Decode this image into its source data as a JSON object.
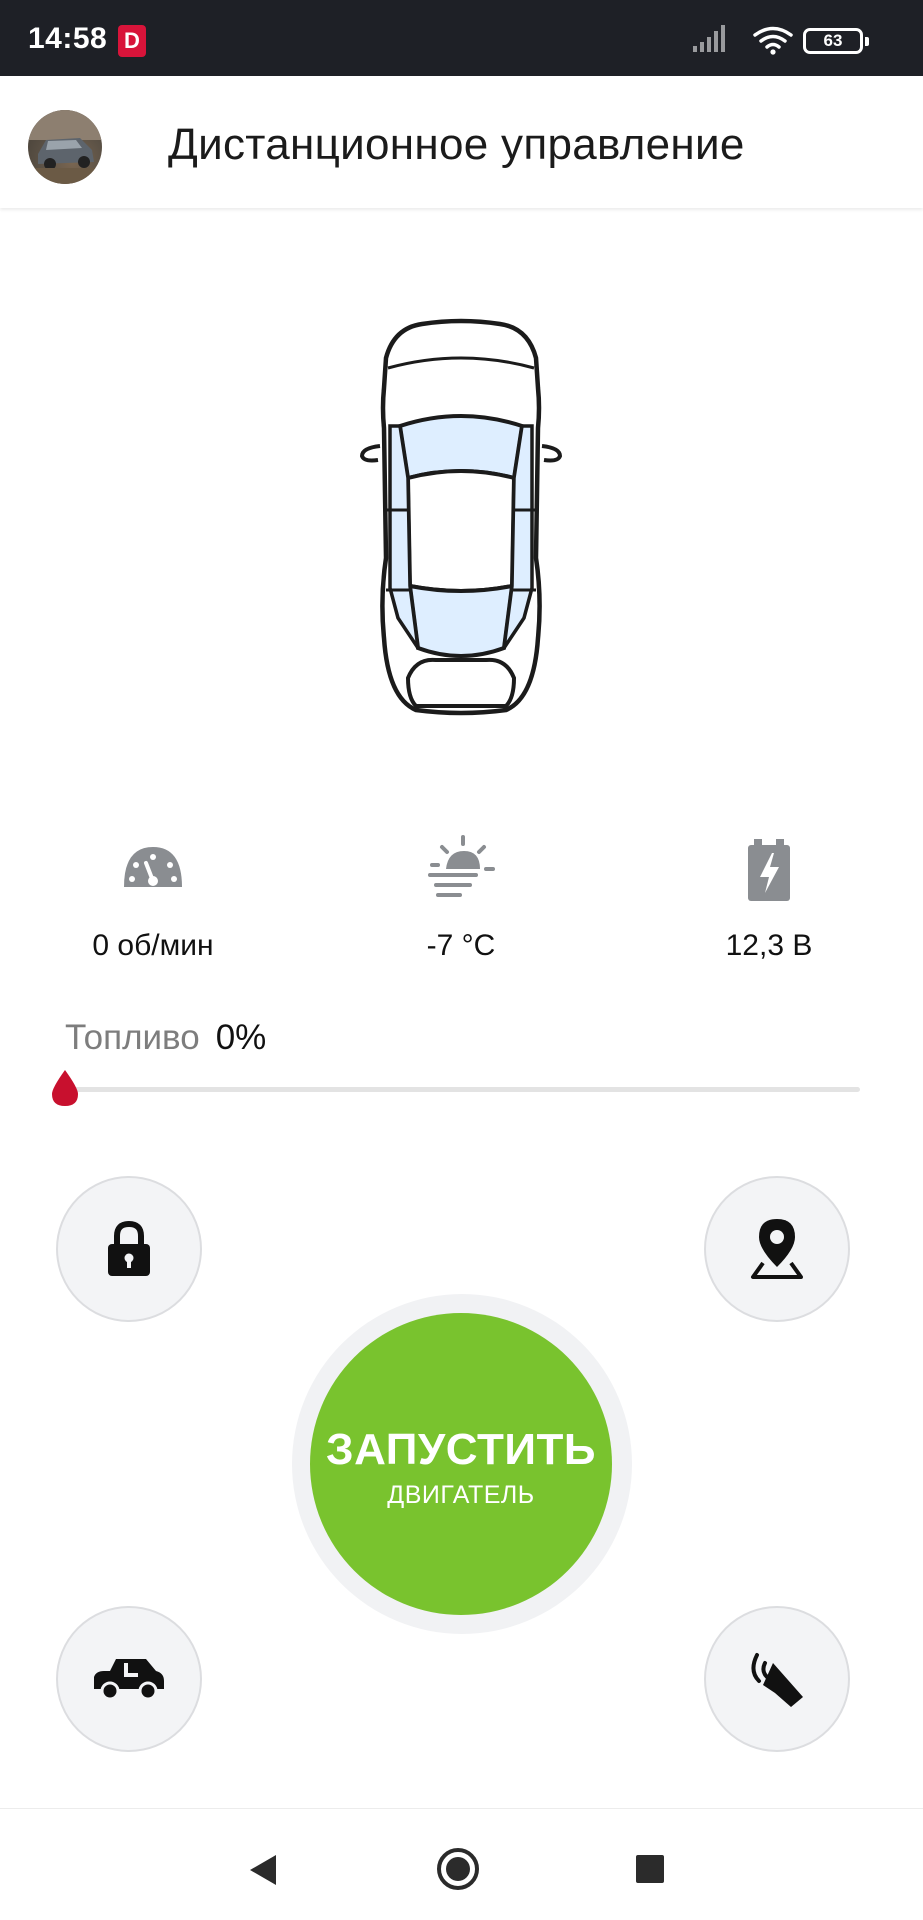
{
  "status_bar": {
    "time": "14:58",
    "app_badge": "D",
    "battery_level": "63"
  },
  "header": {
    "title": "Дистанционное управление",
    "avatar_icon": "car-photo-avatar"
  },
  "stats": {
    "rpm": {
      "icon": "speedometer-icon",
      "value": "0 об/мин"
    },
    "temperature": {
      "icon": "weather-sun-fog-icon",
      "value": "-7 °C"
    },
    "voltage": {
      "icon": "battery-charge-icon",
      "value": "12,3 В"
    }
  },
  "fuel": {
    "label": "Топливо",
    "value": "0%",
    "level": 0,
    "color": "#c8102e"
  },
  "actions": {
    "lock": {
      "icon": "lock-icon"
    },
    "location": {
      "icon": "map-pin-icon"
    },
    "trunk": {
      "icon": "car-trunk-icon"
    },
    "horn": {
      "icon": "horn-icon"
    }
  },
  "start_button": {
    "title": "ЗАПУСТИТЬ",
    "subtitle": "ДВИГАТЕЛЬ",
    "color": "#79c32e"
  },
  "nav": {
    "back_icon": "back-triangle-icon",
    "home_icon": "home-circle-icon",
    "recent_icon": "recent-square-icon"
  }
}
